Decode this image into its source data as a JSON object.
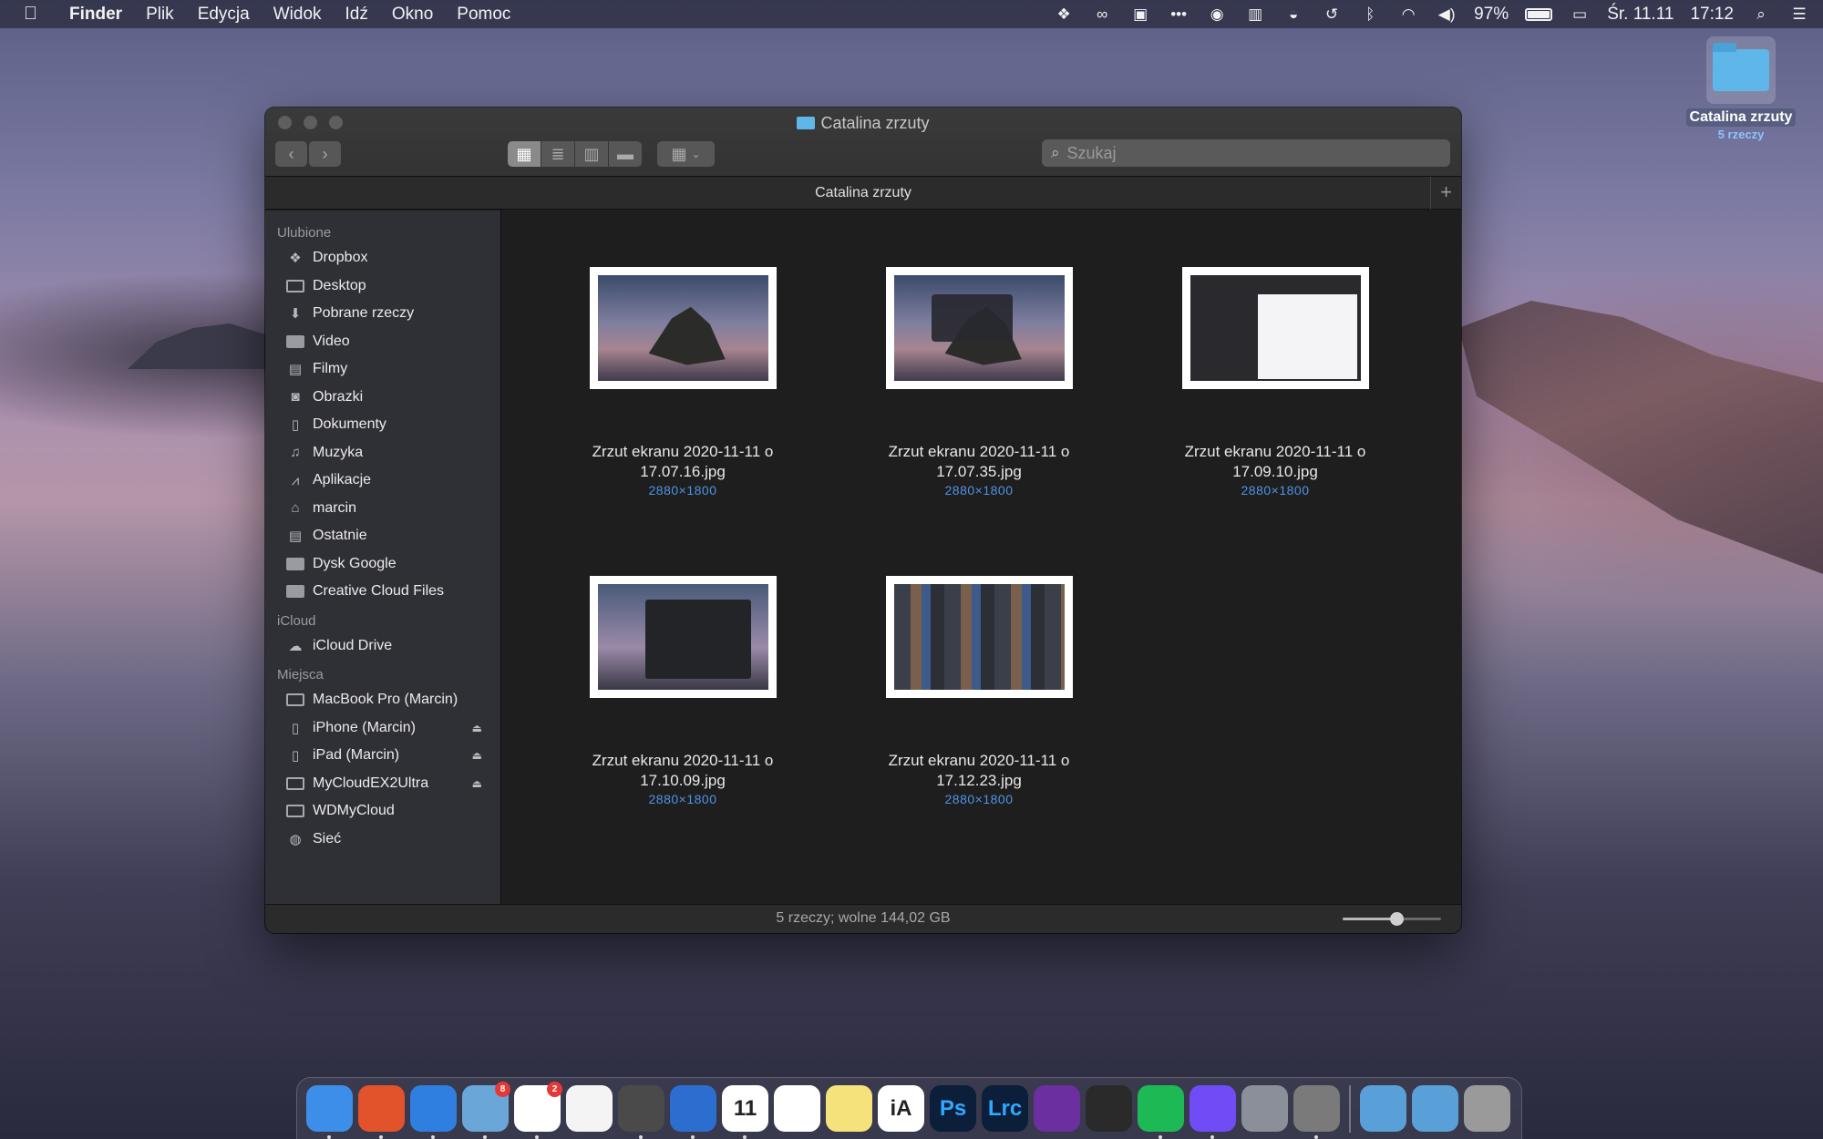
{
  "menubar": {
    "apple": "",
    "items": [
      "Finder",
      "Plik",
      "Edycja",
      "Widok",
      "Idź",
      "Okno",
      "Pomoc"
    ],
    "battery_percent": "97%",
    "date": "Śr. 11.11",
    "time": "17:12",
    "status_icons": [
      "dropbox-icon",
      "creative-cloud-icon",
      "notification-icon",
      "more-icon",
      "control-icon",
      "layout-icon",
      "cup-icon",
      "time-machine-icon",
      "bluetooth-icon",
      "wifi-icon",
      "volume-icon"
    ]
  },
  "desktop_folder": {
    "name": "Catalina zrzuty",
    "count": "5 rzeczy"
  },
  "window": {
    "title": "Catalina zrzuty",
    "path_title": "Catalina zrzuty",
    "search_placeholder": "Szukaj",
    "status": "5 rzeczy; wolne 144,02 GB",
    "icon_size_level": 0.55
  },
  "sidebar": {
    "sections": [
      {
        "heading": "Ulubione",
        "items": [
          {
            "label": "Dropbox",
            "icon": "dropbox-icon"
          },
          {
            "label": "Desktop",
            "icon": "desktop-icon"
          },
          {
            "label": "Pobrane rzeczy",
            "icon": "download-icon"
          },
          {
            "label": "Video",
            "icon": "folder-icon"
          },
          {
            "label": "Filmy",
            "icon": "film-icon"
          },
          {
            "label": "Obrazki",
            "icon": "camera-icon"
          },
          {
            "label": "Dokumenty",
            "icon": "document-icon"
          },
          {
            "label": "Muzyka",
            "icon": "music-icon"
          },
          {
            "label": "Aplikacje",
            "icon": "applications-icon"
          },
          {
            "label": "marcin",
            "icon": "home-icon"
          },
          {
            "label": "Ostatnie",
            "icon": "recents-icon"
          },
          {
            "label": "Dysk Google",
            "icon": "folder-icon"
          },
          {
            "label": "Creative Cloud Files",
            "icon": "folder-icon"
          }
        ]
      },
      {
        "heading": "iCloud",
        "items": [
          {
            "label": "iCloud Drive",
            "icon": "cloud-icon"
          }
        ]
      },
      {
        "heading": "Miejsca",
        "items": [
          {
            "label": "MacBook Pro (Marcin)",
            "icon": "laptop-icon"
          },
          {
            "label": "iPhone (Marcin)",
            "icon": "phone-icon",
            "eject": true
          },
          {
            "label": "iPad (Marcin)",
            "icon": "tablet-icon",
            "eject": true
          },
          {
            "label": "MyCloudEX2Ultra",
            "icon": "monitor-icon",
            "eject": true
          },
          {
            "label": "WDMyCloud",
            "icon": "monitor-icon"
          },
          {
            "label": "Sieć",
            "icon": "network-icon"
          }
        ]
      }
    ]
  },
  "files": [
    {
      "name_line1": "Zrzut ekranu 2020-11-11 o",
      "name_line2": "17.07.16.jpg",
      "size": "2880×1800"
    },
    {
      "name_line1": "Zrzut ekranu 2020-11-11 o",
      "name_line2": "17.07.35.jpg",
      "size": "2880×1800"
    },
    {
      "name_line1": "Zrzut ekranu 2020-11-11 o",
      "name_line2": "17.09.10.jpg",
      "size": "2880×1800"
    },
    {
      "name_line1": "Zrzut ekranu 2020-11-11 o",
      "name_line2": "17.10.09.jpg",
      "size": "2880×1800"
    },
    {
      "name_line1": "Zrzut ekranu 2020-11-11 o",
      "name_line2": "17.12.23.jpg",
      "size": "2880×1800"
    }
  ],
  "dock": {
    "apps": [
      {
        "name": "finder",
        "color": "#3d8ee8",
        "text": "",
        "running": true
      },
      {
        "name": "brave",
        "color": "#e2522b",
        "text": "",
        "running": true
      },
      {
        "name": "safari",
        "color": "#2f7fe0",
        "text": "",
        "running": true
      },
      {
        "name": "mail",
        "color": "#6aa7d8",
        "text": "",
        "running": true,
        "badge": "8"
      },
      {
        "name": "slack",
        "color": "#ffffff",
        "text": "",
        "running": true,
        "badge": "2"
      },
      {
        "name": "photos",
        "color": "#f4f4f4",
        "text": "",
        "running": false
      },
      {
        "name": "cloud-app",
        "color": "#4a4a4a",
        "text": "",
        "running": true
      },
      {
        "name": "tasks",
        "color": "#2c6ecf",
        "text": "",
        "running": true
      },
      {
        "name": "calendar",
        "color": "#ffffff",
        "text": "11",
        "running": true
      },
      {
        "name": "reminders",
        "color": "#ffffff",
        "text": "",
        "running": false
      },
      {
        "name": "notes",
        "color": "#f6e27a",
        "text": "",
        "running": false
      },
      {
        "name": "ia-writer",
        "color": "#ffffff",
        "text": "iA",
        "running": false
      },
      {
        "name": "photoshop",
        "color": "#0b1f3a",
        "text": "Ps",
        "running": false
      },
      {
        "name": "lightroom",
        "color": "#0b1f3a",
        "text": "Lrc",
        "running": false
      },
      {
        "name": "affinity-photo",
        "color": "#6b2fa0",
        "text": "",
        "running": false
      },
      {
        "name": "final-cut",
        "color": "#2a2a2a",
        "text": "",
        "running": false
      },
      {
        "name": "spotify",
        "color": "#1db954",
        "text": "",
        "running": true
      },
      {
        "name": "messenger",
        "color": "#6f4cf5",
        "text": "",
        "running": true
      },
      {
        "name": "launchpad",
        "color": "#8a8f9a",
        "text": "",
        "running": false
      },
      {
        "name": "system-preferences",
        "color": "#7a7a7a",
        "text": "",
        "running": true
      }
    ],
    "stacks": [
      {
        "name": "downloads-stack",
        "color": "#5aa0d8"
      },
      {
        "name": "folder-stack",
        "color": "#5aa0d8"
      },
      {
        "name": "trash",
        "color": "#9a9a9a"
      }
    ]
  }
}
